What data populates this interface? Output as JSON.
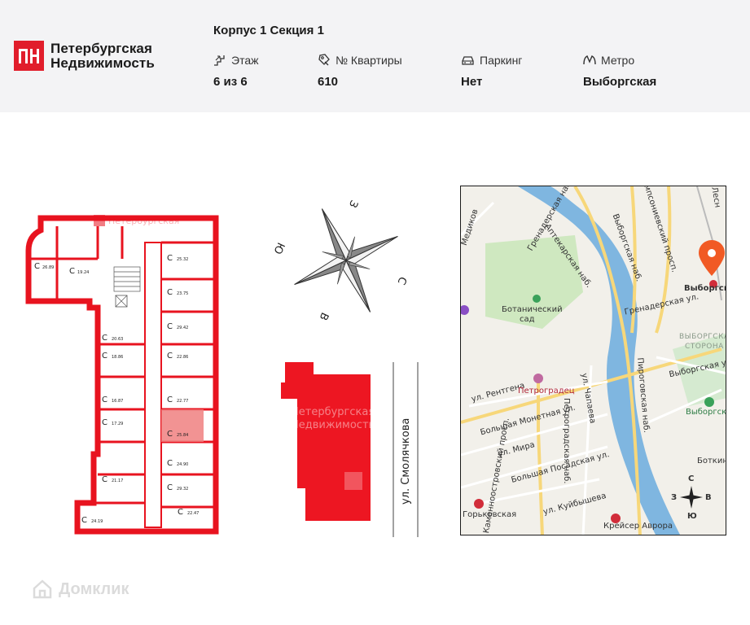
{
  "brand": {
    "name_line1": "Петербургская",
    "name_line2": "Недвижимость",
    "logo_letters": "ПН",
    "accent": "#e11d2b"
  },
  "header": {
    "title": "Корпус 1 Секция 1",
    "stats": [
      {
        "label": "Этаж",
        "value": "6 из 6",
        "icon": "stairs-icon"
      },
      {
        "label": "№ Квартиры",
        "value": "610",
        "icon": "key-icon"
      },
      {
        "label": "Паркинг",
        "value": "Нет",
        "icon": "car-icon"
      },
      {
        "label": "Метро",
        "value": "Выборгская",
        "icon": "metro-icon"
      }
    ]
  },
  "compass": {
    "n": "С",
    "s": "Ю",
    "e": "В",
    "w": "З"
  },
  "street": "ул. Смолячкова",
  "watermark": {
    "line1": "Петербургская",
    "line2": "Недвижимость"
  },
  "floorplan": {
    "rooms": [
      {
        "label": "С",
        "area": "26.89"
      },
      {
        "label": "С",
        "area": "19.24"
      },
      {
        "label": "С",
        "area": "25.32"
      },
      {
        "label": "С",
        "area": "23.75"
      },
      {
        "label": "С",
        "area": "20.63"
      },
      {
        "label": "С",
        "area": "29.42"
      },
      {
        "label": "С",
        "area": "18.86"
      },
      {
        "label": "С",
        "area": "22.86"
      },
      {
        "label": "С",
        "area": "16.87"
      },
      {
        "label": "С",
        "area": "22.77"
      },
      {
        "label": "С",
        "area": "17.29"
      },
      {
        "label": "С",
        "area": "25.84"
      },
      {
        "label": "С",
        "area": "24.90"
      },
      {
        "label": "С",
        "area": "21.17"
      },
      {
        "label": "С",
        "area": "29.32"
      },
      {
        "label": "С",
        "area": "24.19"
      },
      {
        "label": "С",
        "area": "22.47"
      }
    ]
  },
  "map": {
    "streets": {
      "grenaderskaya_nab": "Гренадерская наб.",
      "aptekarskaya_nab": "Аптекарская наб.",
      "vyborgskaya_nab": "Выборгская наб.",
      "samp_prosp": "Сампсониевский просп.",
      "grenaderskaya_ul": "Гренадерская ул.",
      "medikov": "Медиков",
      "rentgena": "ул. Рентгена",
      "chapaeva": "ул. Чапаева",
      "b_monetnaya": "Большая Монетная ул.",
      "mira": "ул. Мира",
      "b_posadskaya": "Большая Посадская ул.",
      "kuibysheva": "ул. Куйбышева",
      "petrogradskaya_nab": "Петроградская наб.",
      "pirogovskaya_nab": "Пироговская наб.",
      "vyborgskaya_ul": "Выборгская ул.",
      "kamennoostrovsky": "Каменноостровский просп.",
      "botkinskaya": "Боткин",
      "lesnoy": "Лесн"
    },
    "pois": {
      "botanical": "Ботанический",
      "botanical2": "сад",
      "petrogradets": "Петроградец",
      "vyborgskaya_storona": "ВЫБОРГСКАЯ",
      "vyborgskaya_storona2": "СТОРОНА",
      "vyborgsky": "Выборгский",
      "gorkovskaya": "Горьковская",
      "kreiser": "Крейсер Аврора",
      "metro_target": "Выборгская"
    },
    "compass": {
      "n": "С",
      "s": "Ю",
      "e": "В",
      "w": "З"
    },
    "marker_color": "#f15a24"
  },
  "footer": {
    "brand": "Домклик"
  }
}
